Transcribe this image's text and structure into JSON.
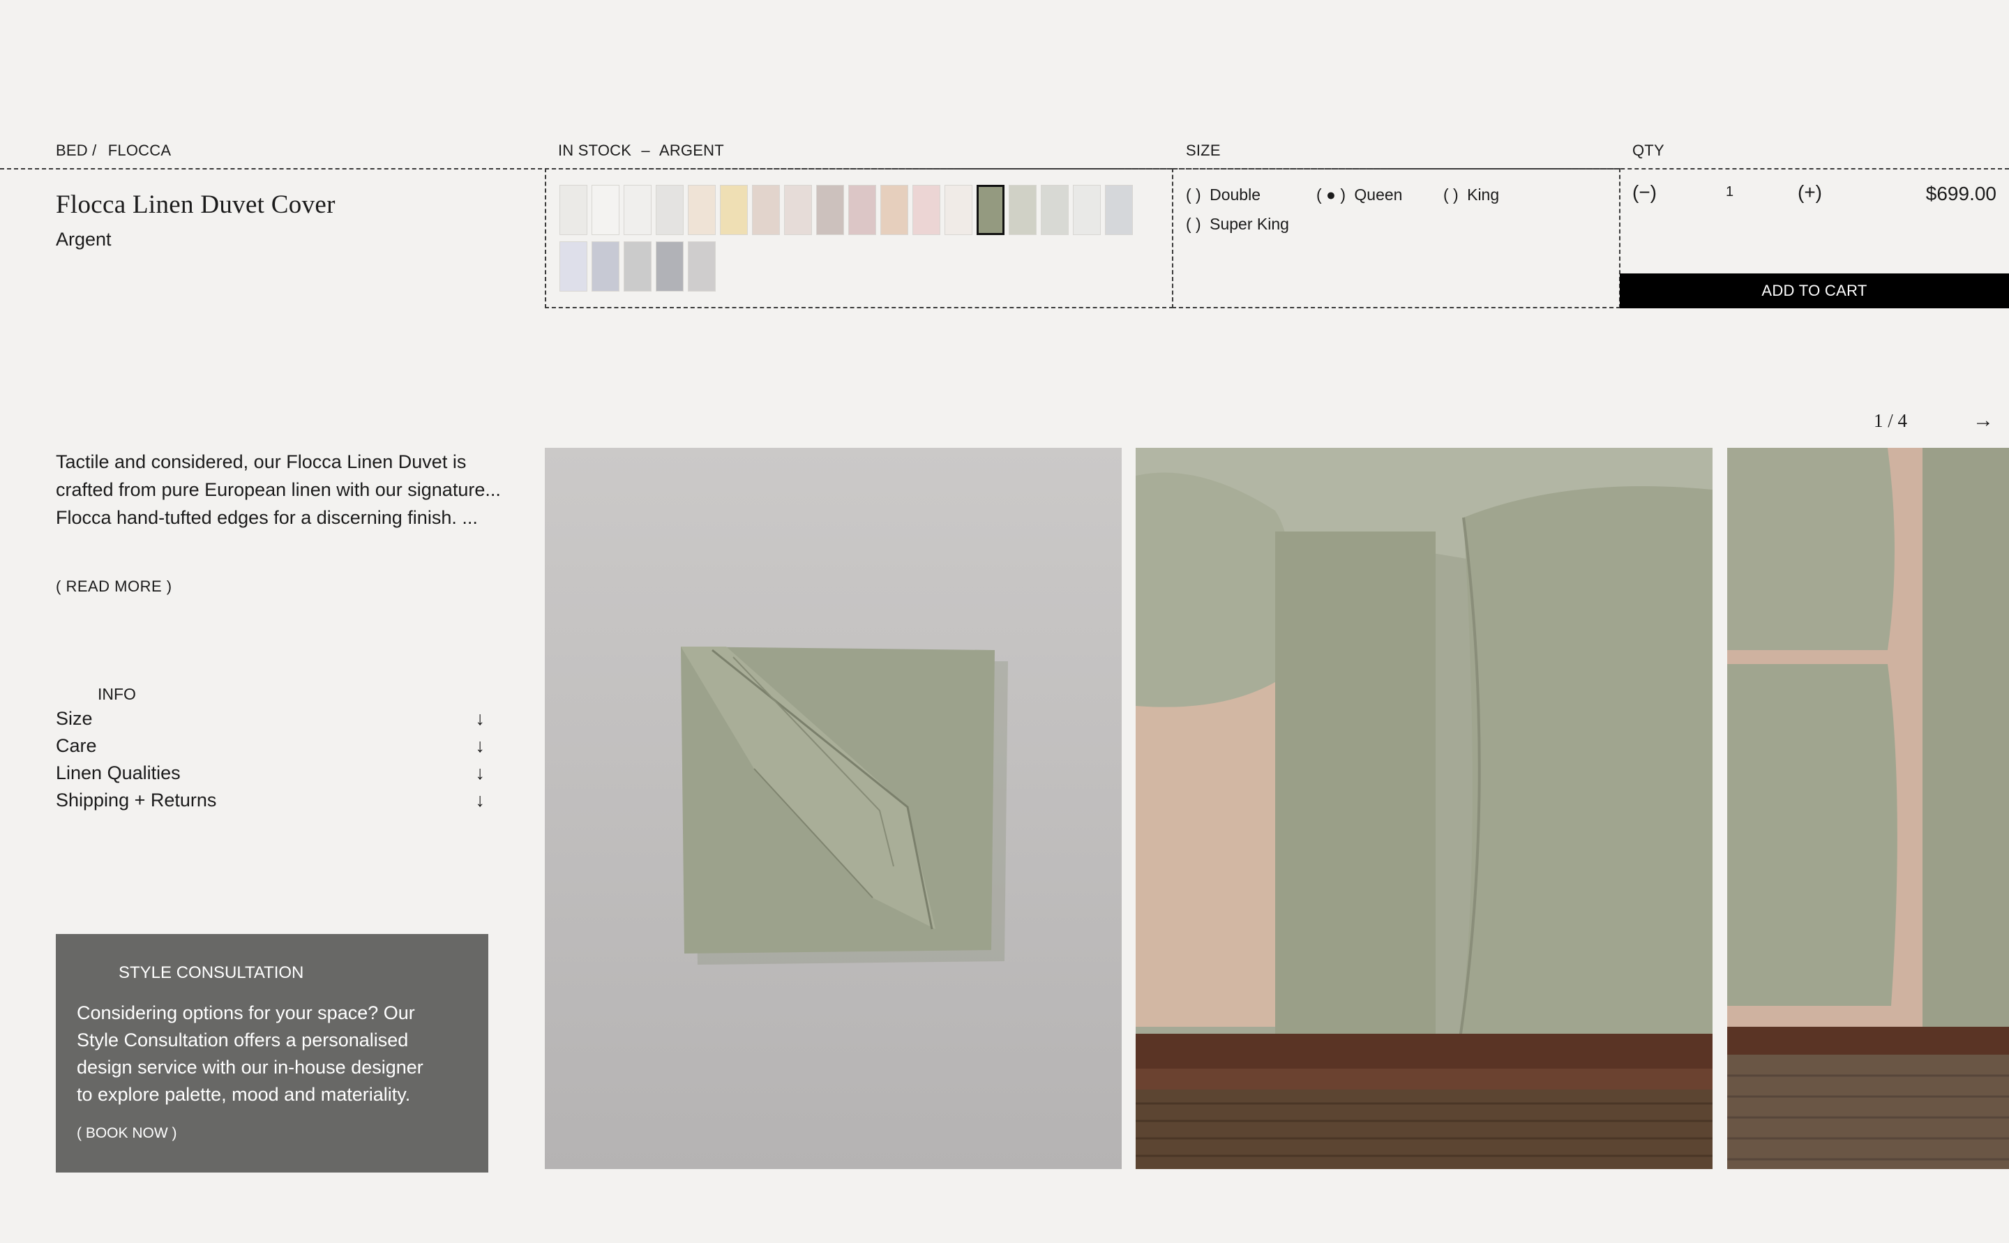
{
  "breadcrumb": {
    "part1": "BED /",
    "part2": "FLOCCA"
  },
  "product": {
    "title": "Flocca Linen Duvet Cover",
    "variant": "Argent"
  },
  "stock": {
    "status": "IN STOCK",
    "separator": "–",
    "colour": "ARGENT"
  },
  "swatches": {
    "row1": [
      "#ebeae7",
      "#f4f3f1",
      "#f0efed",
      "#e4e3e1",
      "#efe3d6",
      "#efdfb4",
      "#e2d4cc",
      "#e6dcd8",
      "#ccc1bd",
      "#dcc6c6",
      "#e6cfbd",
      "#ecd5d4",
      "#f0ebe7",
      "#949a80",
      "#d0d1c6",
      "#d8d9d4",
      "#e9e9e7",
      "#d5d7da"
    ],
    "row2": [
      "#dedfea",
      "#c7c9d4",
      "#cbcbcb",
      "#b1b2b7",
      "#cfcdcd"
    ],
    "selected_index": 13
  },
  "size": {
    "label": "SIZE",
    "options": [
      {
        "marker": "(   )",
        "label": "Double"
      },
      {
        "marker": "( ● )",
        "label": "Queen"
      },
      {
        "marker": "(   )",
        "label": "King"
      },
      {
        "marker": "(   )",
        "label": "Super King"
      }
    ],
    "selected": "Queen"
  },
  "qty": {
    "label": "QTY",
    "minus": "(−)",
    "value": "1",
    "plus": "(+)",
    "price": "$699.00"
  },
  "cart": {
    "label": "ADD TO CART"
  },
  "description": {
    "lines": [
      "Tactile and considered, our Flocca Linen Duvet is",
      "crafted from pure European linen with our signature...",
      "Flocca hand-tufted edges for a discerning finish. ..."
    ],
    "read_more": "( READ MORE )"
  },
  "info": {
    "heading": "INFO",
    "items": [
      "Size",
      "Care",
      "Linen Qualities",
      "Shipping + Returns"
    ],
    "arrow": "↓"
  },
  "consultation": {
    "heading": "STYLE CONSULTATION",
    "lines": [
      "Considering options for your space? Our",
      "Style Consultation offers a personalised",
      "design service with our in-house designer",
      "to explore palette, mood and materiality."
    ],
    "cta": "( BOOK NOW )"
  },
  "gallery": {
    "counter": "1 / 4",
    "next_arrow": "→"
  }
}
